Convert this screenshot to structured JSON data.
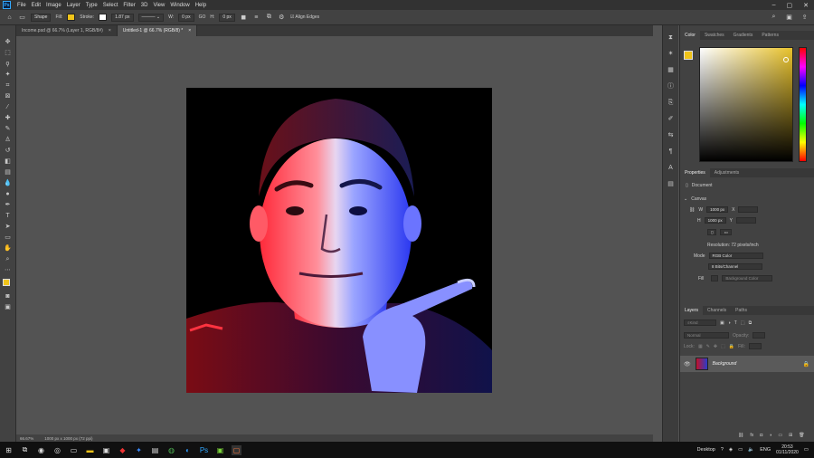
{
  "menubar": {
    "items": [
      "File",
      "Edit",
      "Image",
      "Layer",
      "Type",
      "Select",
      "Filter",
      "3D",
      "View",
      "Window",
      "Help"
    ],
    "logo": "Ps"
  },
  "options": {
    "mode": "Shape",
    "fill_label": "Fill:",
    "stroke_label": "Stroke:",
    "stroke_width": "1.87 px",
    "w_label": "W:",
    "w_value": "0 px",
    "go_label": "GO",
    "h_label": "H:",
    "h_value": "0 px",
    "align_edges": "Align Edges"
  },
  "tabs": [
    {
      "label": "Income.psd @ 66.7% (Layer 1, RGB/8#)",
      "close": "×",
      "active": false
    },
    {
      "label": "Untitled-1 @ 66.7% (RGB/8) *",
      "close": "×",
      "active": true
    }
  ],
  "status": {
    "zoom": "66.67%",
    "doc_size": "1000 px x 1000 px (72 ppi)"
  },
  "color_panel": {
    "tabs": [
      "Color",
      "Swatches",
      "Gradients",
      "Patterns"
    ],
    "fg_color": "#f0c419",
    "bg_color": "#ffffff"
  },
  "properties": {
    "tabs": [
      "Properties",
      "Adjustments"
    ],
    "doc_label": "Document",
    "canvas_label": "Canvas",
    "w_label": "W",
    "w_value": "1000 px",
    "x_label": "X",
    "h_label": "H",
    "h_value": "1000 px",
    "y_label": "Y",
    "resolution": "Resolution: 72 pixels/inch",
    "mode_label": "Mode",
    "mode_value": "RGB Color",
    "depth_value": "8 Bits/Channel",
    "fill_label": "Fill",
    "fill_value": "Background Color"
  },
  "layers": {
    "tabs": [
      "Layers",
      "Channels",
      "Paths"
    ],
    "search": "Kind",
    "blend": "Normal",
    "opacity_label": "Opacity:",
    "lock_label": "Lock:",
    "fill_label": "Fill:",
    "layer_name": "Background"
  },
  "taskbar": {
    "desktop": "Desktop",
    "lang": "ENG",
    "time": "20:53",
    "date": "01/11/2020"
  }
}
